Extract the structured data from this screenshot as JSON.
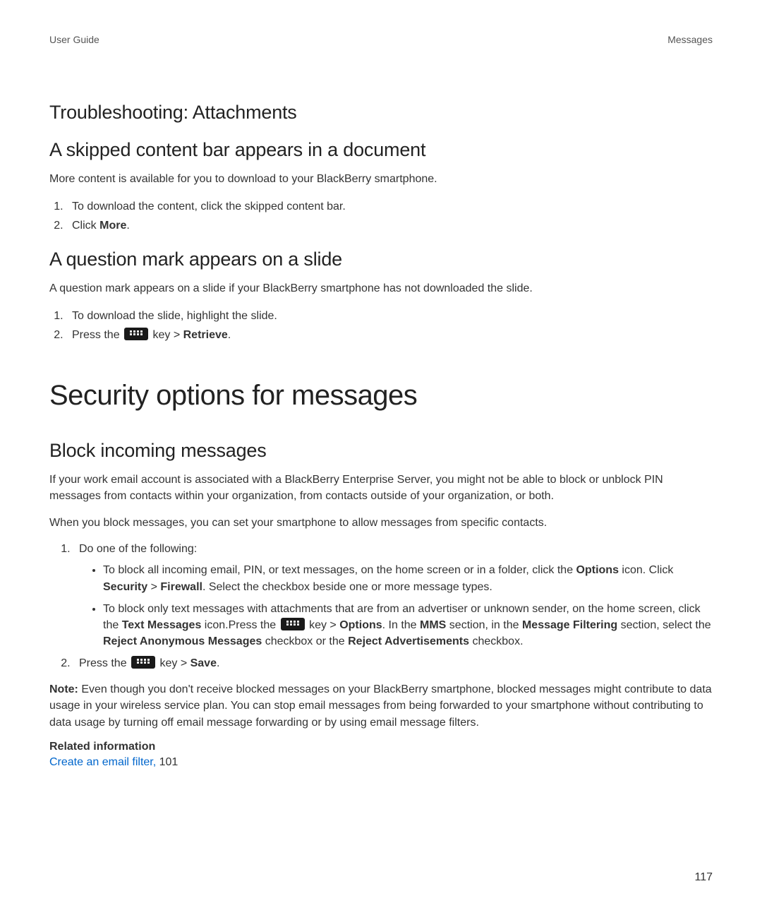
{
  "header": {
    "left": "User Guide",
    "right": "Messages"
  },
  "s1": {
    "title": "Troubleshooting: Attachments",
    "sub1": {
      "title": "A skipped content bar appears in a document",
      "para": "More content is available for you to download to your BlackBerry smartphone.",
      "steps": {
        "i1": "To download the content, click the skipped content bar.",
        "i2_pre": "Click ",
        "i2_b": "More",
        "i2_post": "."
      }
    },
    "sub2": {
      "title": "A question mark appears on a slide",
      "para": "A question mark appears on a slide if your BlackBerry smartphone has not downloaded the slide.",
      "steps": {
        "i1": "To download the slide, highlight the slide.",
        "i2_pre": "Press the ",
        "i2_mid": " key > ",
        "i2_b": "Retrieve",
        "i2_post": "."
      }
    }
  },
  "s2": {
    "title": "Security options for messages",
    "sub1": {
      "title": "Block incoming messages",
      "p1": "If your work email account is associated with a BlackBerry Enterprise Server, you might not be able to block or unblock PIN messages from contacts within your organization, from contacts outside of your organization, or both.",
      "p2": "When you block messages, you can set your smartphone to allow messages from specific contacts.",
      "step1": "Do one of the following:",
      "b1": {
        "t1": "To block all incoming email, PIN, or text messages, on the home screen or in a folder, click the ",
        "b_options": "Options",
        "t2": " icon. Click ",
        "b_security": "Security",
        "t3": " > ",
        "b_firewall": "Firewall",
        "t4": ". Select the checkbox beside one or more message types."
      },
      "b2": {
        "t1": "To block only text messages with attachments that are from an advertiser or unknown sender, on the home screen, click the ",
        "b_tm": "Text Messages",
        "t2": " icon.Press the ",
        "t3": " key > ",
        "b_options": "Options",
        "t4": ". In the ",
        "b_mms": "MMS",
        "t5": " section, in the ",
        "b_mf": "Message Filtering",
        "t6": " section, select the ",
        "b_ram": "Reject Anonymous Messages",
        "t7": " checkbox or the ",
        "b_ra": "Reject Advertisements",
        "t8": " checkbox."
      },
      "step2": {
        "pre": "Press the ",
        "mid": " key > ",
        "b": "Save",
        "post": "."
      },
      "note": {
        "label": "Note: ",
        "text": "Even though you don't receive blocked messages on your BlackBerry smartphone, blocked messages might contribute to data usage in your wireless service plan. You can stop email messages from being forwarded to your smartphone without contributing to data usage by turning off email message forwarding or by using email message filters."
      },
      "related": {
        "heading": "Related information",
        "link_text": "Create an email filter, ",
        "link_ref": "101"
      }
    }
  },
  "page_number": "117"
}
